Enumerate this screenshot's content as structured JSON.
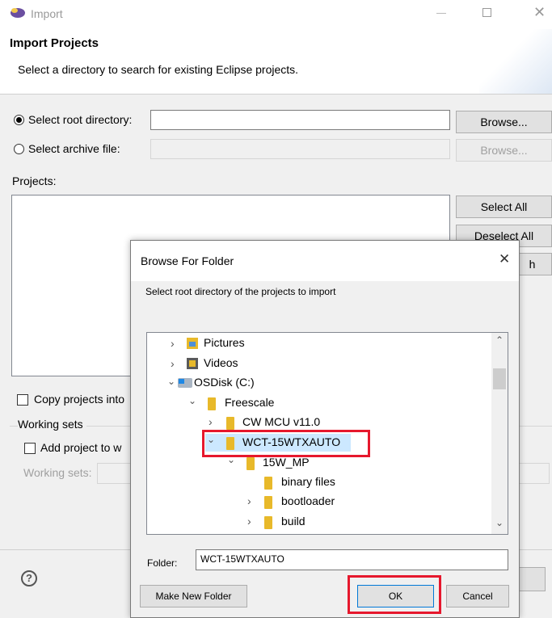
{
  "window": {
    "title": "Import",
    "header_title": "Import Projects",
    "header_desc": "Select a directory to search for existing Eclipse projects."
  },
  "source": {
    "root_label": "Select root directory:",
    "root_value": "",
    "archive_label": "Select archive file:",
    "archive_value": "",
    "browse_label": "Browse...",
    "browse_disabled_label": "Browse..."
  },
  "projects": {
    "label": "Projects:",
    "select_all": "Select All",
    "deselect_all": "Deselect All",
    "partial_button": "h"
  },
  "options": {
    "copy_projects": "Copy projects into",
    "working_sets_group": "Working sets",
    "add_to_ws": "Add project to w",
    "working_sets_label": "Working sets:"
  },
  "help_icon": "?",
  "dialog": {
    "title": "Browse For Folder",
    "instruction": "Select root directory of the projects to import",
    "tree": [
      {
        "label": "Pictures",
        "icon": "pictures-folder-icon"
      },
      {
        "label": "Videos",
        "icon": "videos-folder-icon"
      },
      {
        "label": "OSDisk (C:)",
        "icon": "drive-icon"
      },
      {
        "label": "Freescale",
        "icon": "folder-icon"
      },
      {
        "label": "CW MCU v11.0",
        "icon": "folder-icon"
      },
      {
        "label": "WCT-15WTXAUTO",
        "icon": "folder-icon",
        "selected": true
      },
      {
        "label": "15W_MP",
        "icon": "folder-icon"
      },
      {
        "label": "binary files",
        "icon": "folder-icon"
      },
      {
        "label": "bootloader",
        "icon": "folder-icon"
      },
      {
        "label": "build",
        "icon": "folder-icon"
      }
    ],
    "folder_label": "Folder:",
    "folder_value": "WCT-15WTXAUTO",
    "make_new_folder": "Make New Folder",
    "ok": "OK",
    "cancel": "Cancel"
  },
  "colors": {
    "highlight": "#e6182d",
    "selection": "#cce8ff",
    "folder": "#e8b92a"
  }
}
